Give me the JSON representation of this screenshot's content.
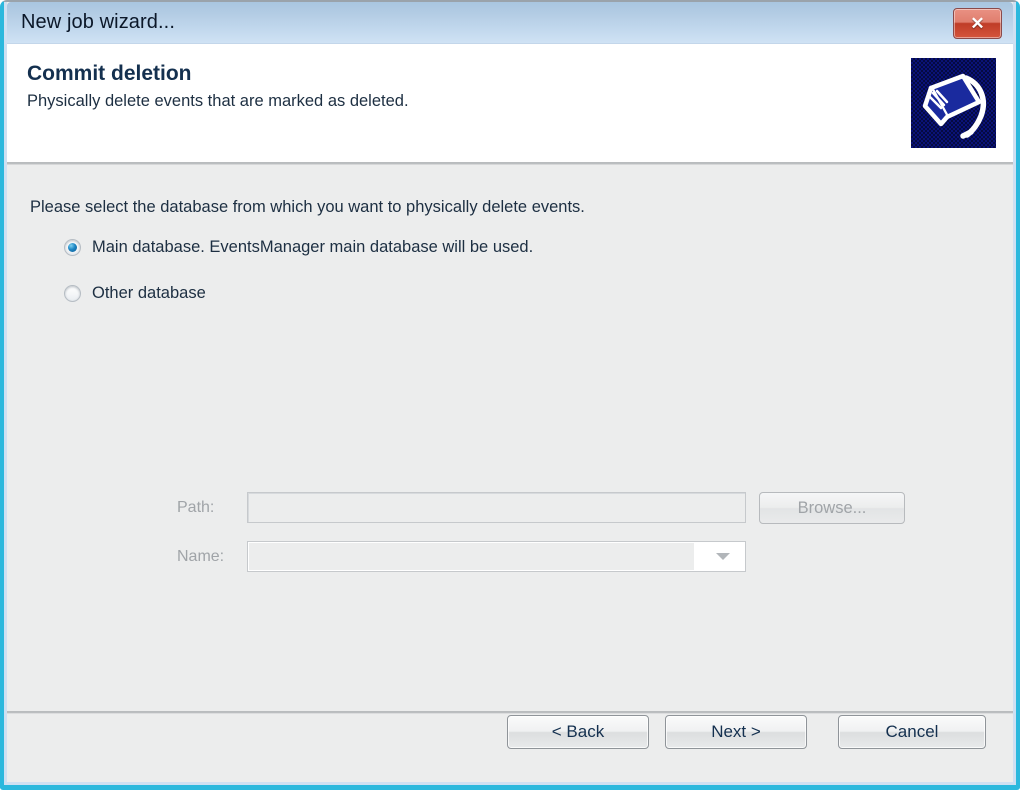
{
  "window": {
    "title": "New job wizard...",
    "close_label": "✕",
    "frame_accent": "#2cb8dd",
    "titlebar_color": "#b3cce4"
  },
  "header": {
    "title": "Commit deletion",
    "subtitle": "Physically delete events that are marked as deleted.",
    "icon": "bucket-icon",
    "icon_background": "#0a1278"
  },
  "main": {
    "instruction": "Please select the database from which you want to physically delete events.",
    "radios": [
      {
        "label": "Main database. EventsManager main database will be used.",
        "checked": true
      },
      {
        "label": "Other database",
        "checked": false
      }
    ],
    "fields": {
      "path": {
        "label": "Path:",
        "value": "",
        "placeholder": "",
        "enabled": false
      },
      "name": {
        "label": "Name:",
        "value": "",
        "placeholder": "",
        "enabled": false,
        "options": []
      }
    },
    "browse_label": "Browse..."
  },
  "footer": {
    "back_label": "< Back",
    "next_label": "Next >",
    "cancel_label": "Cancel"
  }
}
